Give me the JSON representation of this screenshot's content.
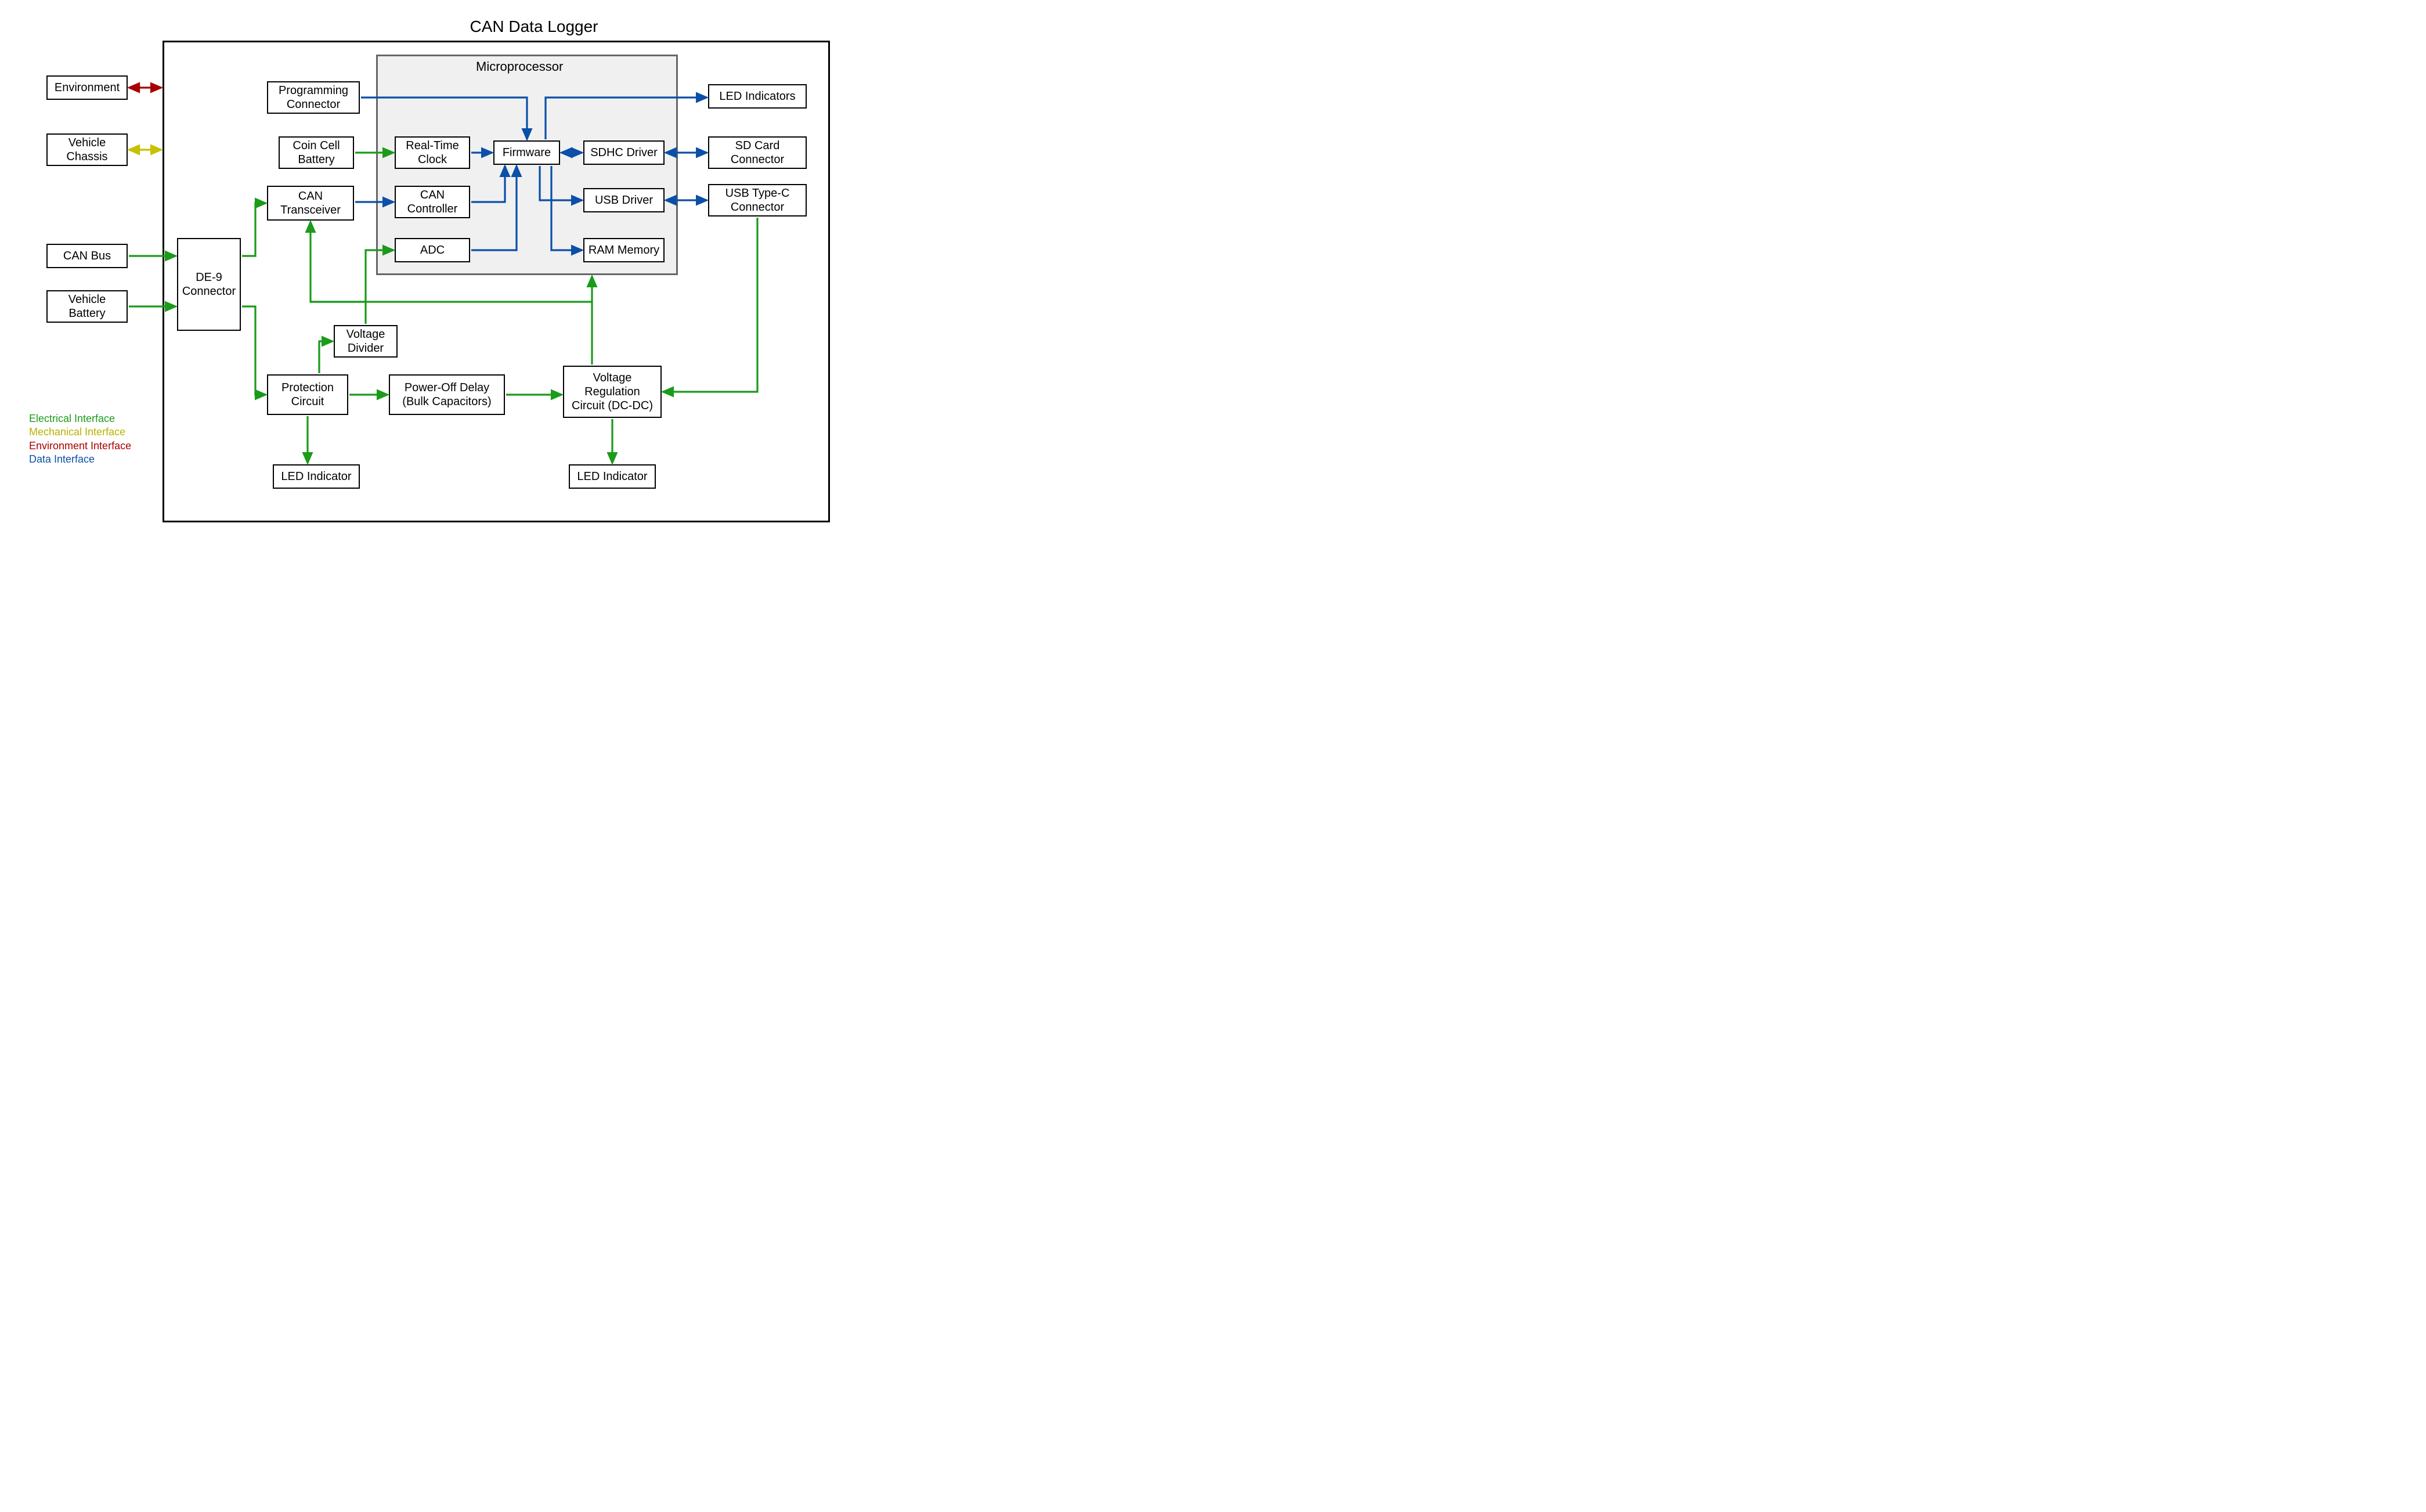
{
  "title": "CAN Data Logger",
  "microTitle": "Microprocessor",
  "blocks": {
    "environment": "Environment",
    "vehicleChassis": "Vehicle\nChassis",
    "canBus": "CAN Bus",
    "vehicleBattery": "Vehicle\nBattery",
    "de9": "DE-9\nConnector",
    "progConn": "Programming\nConnector",
    "coinCell": "Coin Cell\nBattery",
    "canXcvr": "CAN\nTransceiver",
    "rtc": "Real-Time\nClock",
    "canCtrl": "CAN\nController",
    "adc": "ADC",
    "firmware": "Firmware",
    "sdhc": "SDHC Driver",
    "usbDrv": "USB Driver",
    "ram": "RAM Memory",
    "ledInds": "LED Indicators",
    "sdConn": "SD Card\nConnector",
    "usbConn": "USB Type-C\nConnector",
    "voltDiv": "Voltage\nDivider",
    "protCkt": "Protection\nCircuit",
    "pwrOff": "Power-Off Delay\n(Bulk Capacitors)",
    "vreg": "Voltage\nRegulation\nCircuit (DC-DC)",
    "ledInd1": "LED Indicator",
    "ledInd2": "LED Indicator"
  },
  "legend": {
    "electrical": "Electrical Interface",
    "mechanical": "Mechanical Interface",
    "environment": "Environment Interface",
    "data": "Data Interface"
  },
  "colors": {
    "green": "#1a9b1a",
    "yellow": "#c8c000",
    "red": "#a80000",
    "blue": "#0b4fa8"
  }
}
